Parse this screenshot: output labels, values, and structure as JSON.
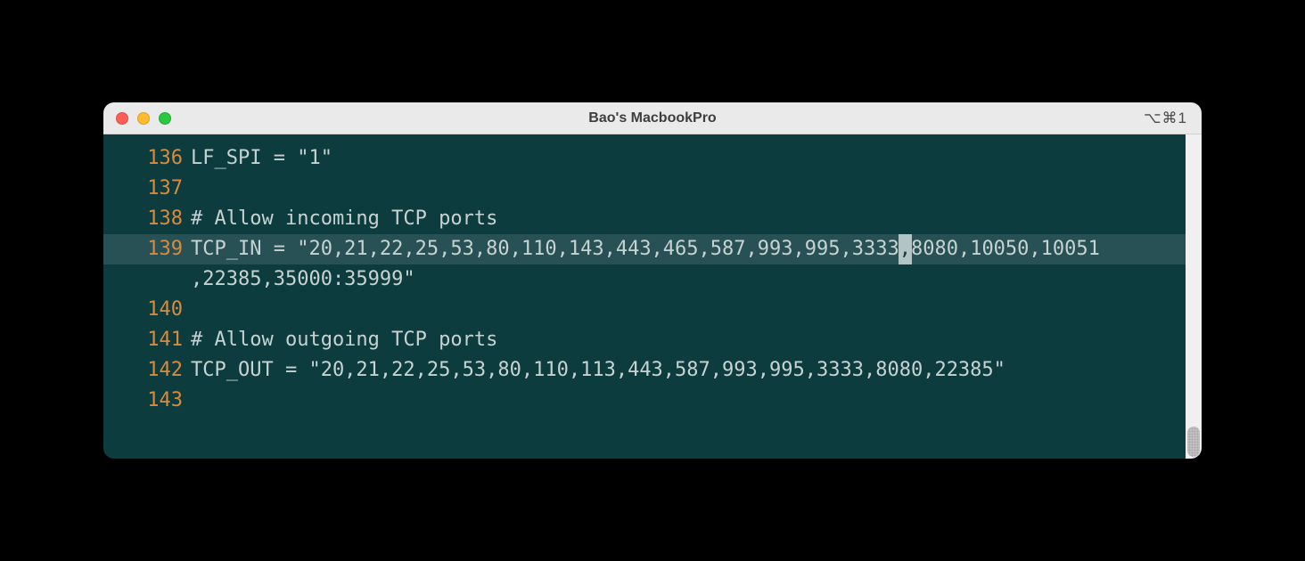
{
  "window": {
    "title": "Bao's MacbookPro",
    "shortcut_hint": "⌥⌘1"
  },
  "editor": {
    "lines": [
      {
        "n": 136,
        "text": "LF_SPI = \"1\"",
        "hl": false
      },
      {
        "n": 137,
        "text": "",
        "hl": false
      },
      {
        "n": 138,
        "text": "# Allow incoming TCP ports",
        "hl": false
      },
      {
        "n": 139,
        "text_pre": "TCP_IN = \"20,21,22,25,53,80,110,143,443,465,587,993,995,3333",
        "cursor_char": ",",
        "text_post": "8080,10050,10051",
        "hl": true,
        "wrapped": true,
        "wrap_text": ",22385,35000:35999\""
      },
      {
        "n": 140,
        "text": "",
        "hl": false
      },
      {
        "n": 141,
        "text": "# Allow outgoing TCP ports",
        "hl": false
      },
      {
        "n": 142,
        "text": "TCP_OUT = \"20,21,22,25,53,80,110,113,443,587,993,995,3333,8080,22385\"",
        "hl": false
      },
      {
        "n": 143,
        "text": "",
        "hl": false
      }
    ]
  }
}
